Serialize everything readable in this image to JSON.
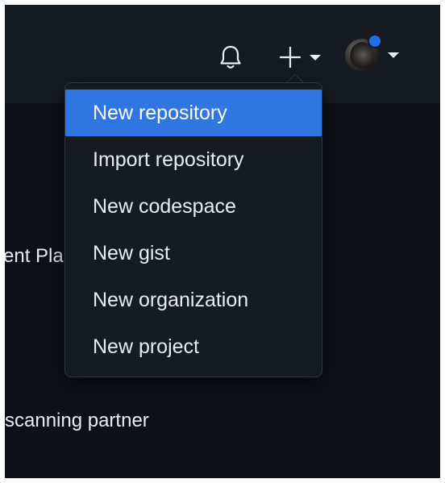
{
  "header": {
    "notifications_icon": "bell-icon",
    "create_icon": "plus-icon",
    "avatar_status_color": "#1f6feb"
  },
  "background": {
    "text_1": "ent Pla",
    "text_2": "scanning partner"
  },
  "create_menu": {
    "items": [
      {
        "label": "New repository"
      },
      {
        "label": "Import repository"
      },
      {
        "label": "New codespace"
      },
      {
        "label": "New gist"
      },
      {
        "label": "New organization"
      },
      {
        "label": "New project"
      }
    ],
    "active_index": 0,
    "active_color": "#2f76e0"
  }
}
